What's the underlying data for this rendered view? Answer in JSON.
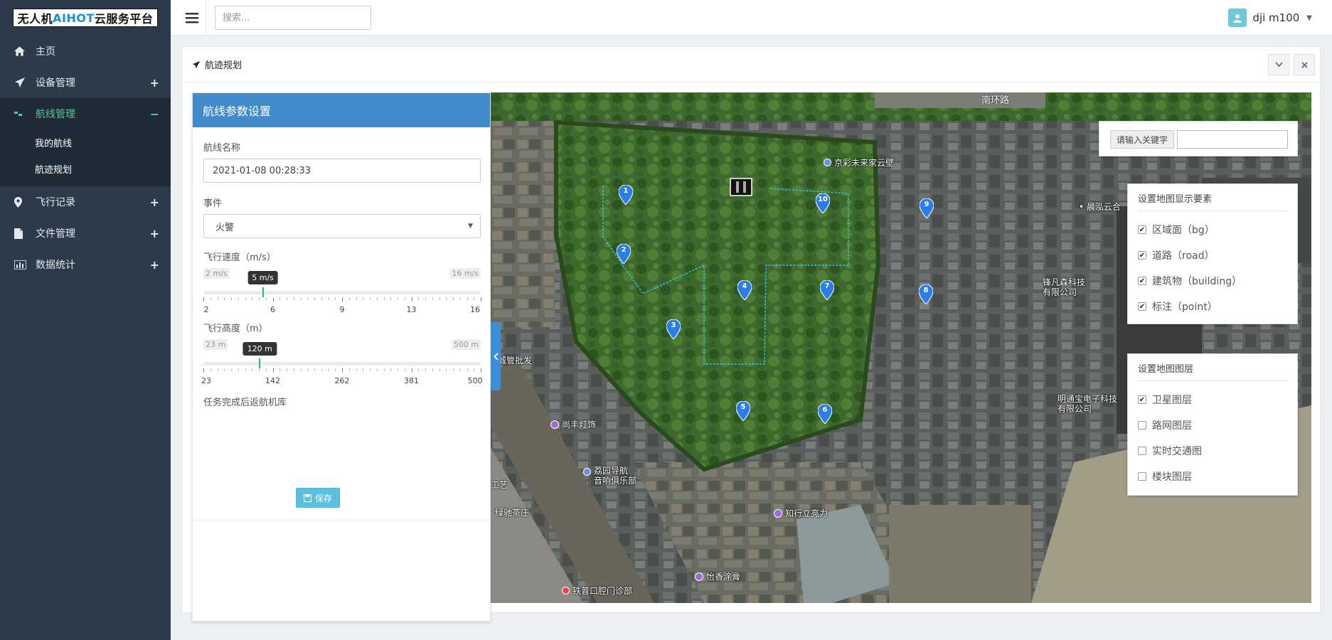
{
  "brand": {
    "logo_text_a": "无人机",
    "logo_text_b": "AIHOT",
    "logo_text_c": "云服务平台"
  },
  "sidebar": {
    "items": [
      {
        "id": "home",
        "label": "主页",
        "icon": "home-icon",
        "expand": ""
      },
      {
        "id": "devices",
        "label": "设备管理",
        "icon": "plane-icon",
        "expand": "+"
      },
      {
        "id": "routes",
        "label": "航线管理",
        "icon": "route-icon",
        "expand": "−",
        "active": true,
        "children": [
          {
            "label": "我的航线"
          },
          {
            "label": "航迹规划"
          }
        ]
      },
      {
        "id": "flight-records",
        "label": "飞行记录",
        "icon": "map-pin-icon",
        "expand": "+"
      },
      {
        "id": "files",
        "label": "文件管理",
        "icon": "file-icon",
        "expand": "+"
      },
      {
        "id": "stats",
        "label": "数据统计",
        "icon": "bar-chart-icon",
        "expand": "+"
      }
    ]
  },
  "topbar": {
    "search_placeholder": "搜索...",
    "username": "dji m100"
  },
  "box": {
    "title": "航迹规划"
  },
  "panel": {
    "title": "航线参数设置",
    "name_label": "航线名称",
    "name_value": "2021-01-08 00:28:33",
    "event_label": "事件",
    "event_value": "火警",
    "speed": {
      "label": "飞行速度（m/s）",
      "min_label": "2 m/s",
      "max_label": "16 m/s",
      "value_label": "5 m/s",
      "min": 2,
      "max": 16,
      "value": 5,
      "ticks": [
        "2",
        "6",
        "9",
        "13",
        "16"
      ]
    },
    "altitude": {
      "label": "飞行高度（m）",
      "min_label": "23 m",
      "max_label": "500 m",
      "value_label": "120 m",
      "min": 23,
      "max": 500,
      "value": 120,
      "ticks": [
        "23",
        "142",
        "262",
        "381",
        "500"
      ]
    },
    "return_label": "任务完成后返航机库",
    "save_label": "保存"
  },
  "map": {
    "labels": {
      "road_top": "南环路",
      "poi_1": "京彩未来家云壁",
      "poi_2": "晨泓云合",
      "poi_3": "锋凡森科技\n有限公司",
      "poi_4": "明通宝电子科技\n有限公司",
      "poi_5": "尚丰灯饰",
      "poi_6": "城管批发",
      "poi_7": "荔园导航\n音响俱乐部",
      "poi_8": "知行立亮力",
      "poi_9": "绿驰茶庄",
      "poi_10": "怡香涂膏",
      "poi_11": "铁普口腔门诊部",
      "poi_12": "工艺"
    },
    "waypoints": [
      "1",
      "2",
      "3",
      "4",
      "5",
      "6",
      "7",
      "8",
      "9",
      "10"
    ],
    "search_label": "请输入关键字",
    "elements_title": "设置地图显示要素",
    "elements": [
      {
        "label": "区域面（bg）",
        "checked": true
      },
      {
        "label": "道路（road）",
        "checked": true
      },
      {
        "label": "建筑物（building）",
        "checked": true
      },
      {
        "label": "标注（point）",
        "checked": true
      }
    ],
    "layers_title": "设置地图图层",
    "layers": [
      {
        "label": "卫星图层",
        "checked": true
      },
      {
        "label": "路网图层",
        "checked": false
      },
      {
        "label": "实时交通图",
        "checked": false
      },
      {
        "label": "楼块图层",
        "checked": false
      }
    ]
  }
}
